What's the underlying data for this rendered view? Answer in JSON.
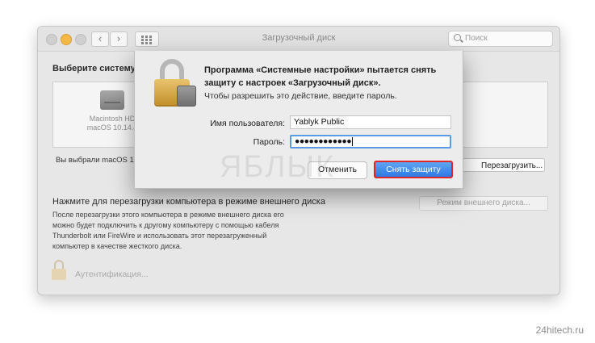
{
  "window": {
    "title": "Загрузочный диск",
    "search_placeholder": "Поиск"
  },
  "main": {
    "choose_label": "Выберите систему",
    "disk": {
      "name": "Macintosh HD",
      "version": "macOS 10.14.4"
    },
    "selected_text": "Вы выбрали macOS 10",
    "restart_button": "Перезагрузить...",
    "target_title": "Нажмите для перезагрузки компьютера в режиме внешнего диска",
    "target_description": "После перезагрузки этого компьютера в режиме внешнего диска его\nможно будет подключить к другому компьютеру с помощью кабеля\nThunderbolt или FireWire и использовать этот перезагруженный\nкомпьютер в качестве жесткого диска.",
    "target_button": "Режим внешнего диска...",
    "auth_label": "Аутентификация..."
  },
  "dialog": {
    "title": "Программа «Системные настройки» пытается снять защиту с настроек «Загрузочный диск».",
    "subtitle": "Чтобы разрешить это действие, введите пароль.",
    "username_label": "Имя пользователя:",
    "username_value": "Yablyk Public",
    "password_label": "Пароль:",
    "password_value": "●●●●●●●●●●●●",
    "cancel_button": "Отменить",
    "ok_button": "Снять защиту"
  },
  "watermark": "ЯБЛЫК",
  "site": "24hitech.ru",
  "colors": {
    "accent_button": "#2f79e6",
    "highlight_border": "#e02626",
    "focus_ring": "#5b9be4"
  }
}
